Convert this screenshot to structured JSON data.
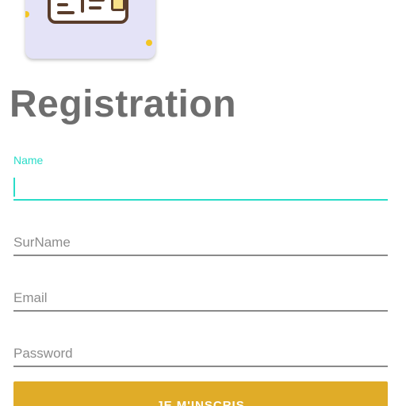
{
  "header": {
    "logo_icon": "id-card-icon",
    "title": "Registration"
  },
  "form": {
    "name": {
      "label": "Name",
      "value": "",
      "state": "focused"
    },
    "surname": {
      "placeholder": "SurName",
      "value": ""
    },
    "email": {
      "placeholder": "Email",
      "value": ""
    },
    "password": {
      "placeholder": "Password",
      "value": ""
    },
    "submit_label": "JE M'INSCRIS"
  },
  "colors": {
    "accent": "#29dcc8",
    "button": "#e0ac28",
    "title": "#6e6e6e",
    "underline": "#8a8a8a"
  }
}
